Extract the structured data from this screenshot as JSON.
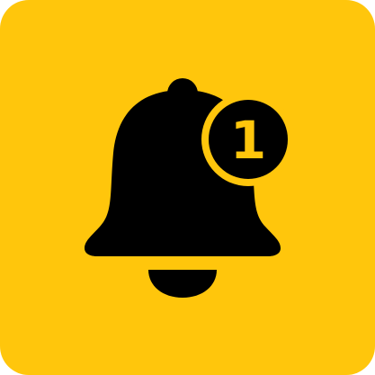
{
  "icon": {
    "name": "notification-bell-icon",
    "background_color": "#FFC60C",
    "glyph_color": "#000000"
  },
  "badge": {
    "count": "1",
    "fill_color": "#000000",
    "ring_color": "#FFC60C",
    "text_color": "#FFC60C"
  }
}
